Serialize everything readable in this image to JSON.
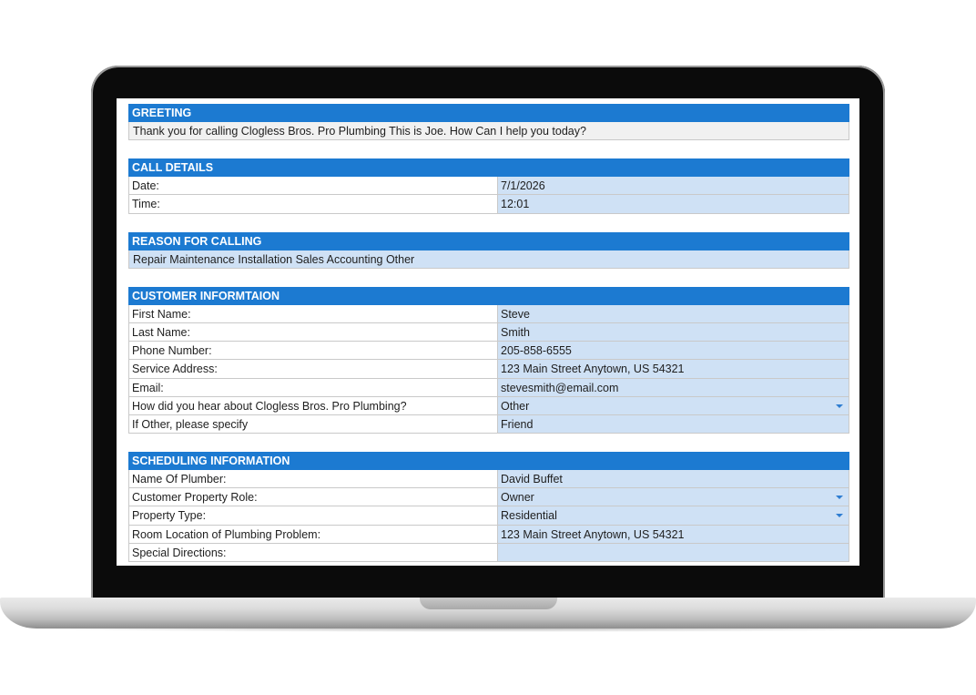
{
  "greeting": {
    "header": "GREETING",
    "text": "Thank you for calling Clogless Bros. Pro Plumbing This is Joe. How Can I help you today?"
  },
  "call_details": {
    "header": "CALL DETAILS",
    "rows": [
      {
        "label": "Date:",
        "value": "7/1/2026"
      },
      {
        "label": "Time:",
        "value": "12:01"
      }
    ]
  },
  "reason": {
    "header": "REASON FOR CALLING",
    "text": "Repair Maintenance Installation Sales Accounting Other"
  },
  "customer": {
    "header": "CUSTOMER INFORMTAION",
    "rows": [
      {
        "label": "First Name:",
        "value": "Steve"
      },
      {
        "label": "Last Name:",
        "value": "Smith"
      },
      {
        "label": "Phone Number:",
        "value": "205-858-6555"
      },
      {
        "label": "Service Address:",
        "value": "123 Main Street Anytown, US 54321"
      },
      {
        "label": "Email:",
        "value": "stevesmith@email.com"
      },
      {
        "label": "How did you hear about Clogless Bros. Pro Plumbing?",
        "value": "Other"
      },
      {
        "label": "If Other, please specify",
        "value": "Friend"
      }
    ]
  },
  "scheduling": {
    "header": "SCHEDULING INFORMATION",
    "rows": [
      {
        "label": "Name Of Plumber:",
        "value": "David Buffet"
      },
      {
        "label": "Customer Property Role:",
        "value": "Owner"
      },
      {
        "label": "Property Type:",
        "value": "Residential"
      },
      {
        "label": "Room Location of Plumbing Problem:",
        "value": "123 Main Street Anytown, US 54321"
      },
      {
        "label": "Special Directions:",
        "value": ""
      }
    ]
  },
  "icons": {
    "dropdown": "chevron-down-icon"
  },
  "colors": {
    "header_bg": "#1c7ad1",
    "input_bg": "#cfe1f5"
  }
}
